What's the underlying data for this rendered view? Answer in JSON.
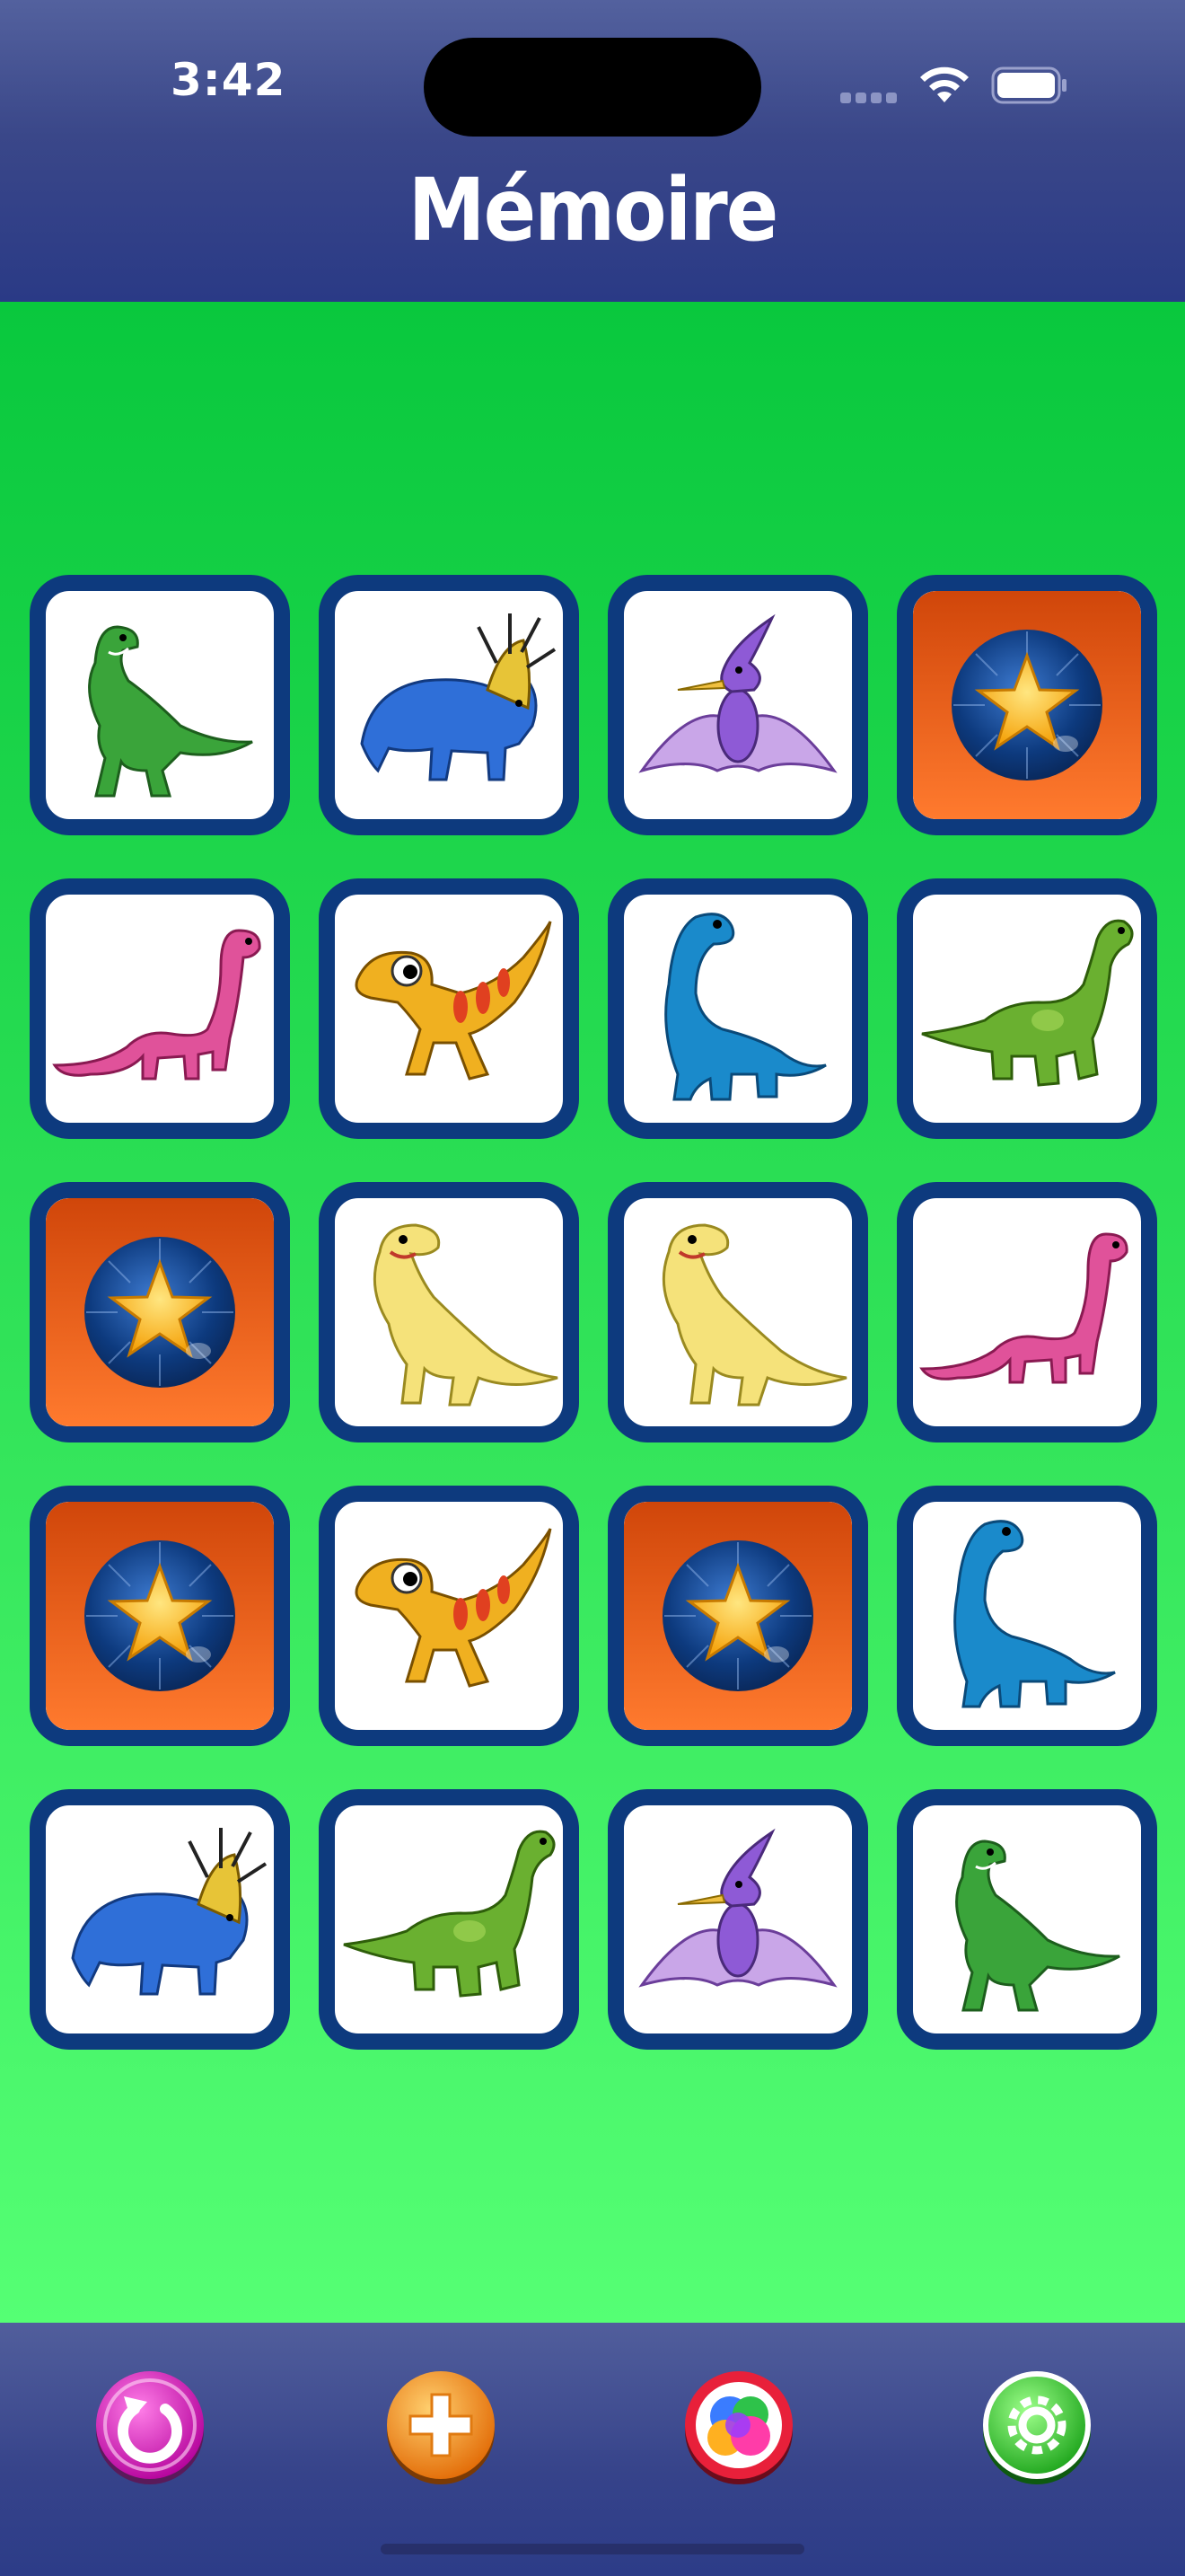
{
  "status_bar": {
    "time": "3:42"
  },
  "header": {
    "title": "Mémoire"
  },
  "board": {
    "rows": 5,
    "columns": 4,
    "cards": [
      {
        "state": "face-up",
        "image": "green-t-rex"
      },
      {
        "state": "face-up",
        "image": "blue-styracosaurus"
      },
      {
        "state": "face-up",
        "image": "purple-pterodactyl"
      },
      {
        "state": "face-down",
        "image": "star-card-back"
      },
      {
        "state": "face-up",
        "image": "pink-brachiosaurus"
      },
      {
        "state": "face-up",
        "image": "yellow-raptor"
      },
      {
        "state": "face-up",
        "image": "blue-brachiosaurus"
      },
      {
        "state": "face-up",
        "image": "green-apatosaurus"
      },
      {
        "state": "face-down",
        "image": "star-card-back"
      },
      {
        "state": "face-up",
        "image": "yellow-tyrannosaur"
      },
      {
        "state": "face-up",
        "image": "yellow-tyrannosaur"
      },
      {
        "state": "face-up",
        "image": "pink-brachiosaurus"
      },
      {
        "state": "face-down",
        "image": "star-card-back"
      },
      {
        "state": "face-up",
        "image": "yellow-raptor"
      },
      {
        "state": "face-down",
        "image": "star-card-back"
      },
      {
        "state": "face-up",
        "image": "blue-brachiosaurus"
      },
      {
        "state": "face-up",
        "image": "blue-styracosaurus"
      },
      {
        "state": "face-up",
        "image": "green-apatosaurus"
      },
      {
        "state": "face-up",
        "image": "purple-pterodactyl"
      },
      {
        "state": "face-up",
        "image": "green-t-rex"
      }
    ]
  },
  "toolbar": {
    "buttons": [
      {
        "icon": "restart-icon",
        "color": "#e21fb8"
      },
      {
        "icon": "plus-icon",
        "color": "#f28a1c"
      },
      {
        "icon": "color-balls-icon",
        "color": "#e8203a"
      },
      {
        "icon": "gear-icon",
        "color": "#3fd13b"
      }
    ]
  },
  "colors": {
    "header_bg": "#3a4789",
    "board_top": "#09c83d",
    "board_bottom": "#55ff74",
    "card_border": "#0d3a7e",
    "card_back": "#ff7a2e"
  }
}
